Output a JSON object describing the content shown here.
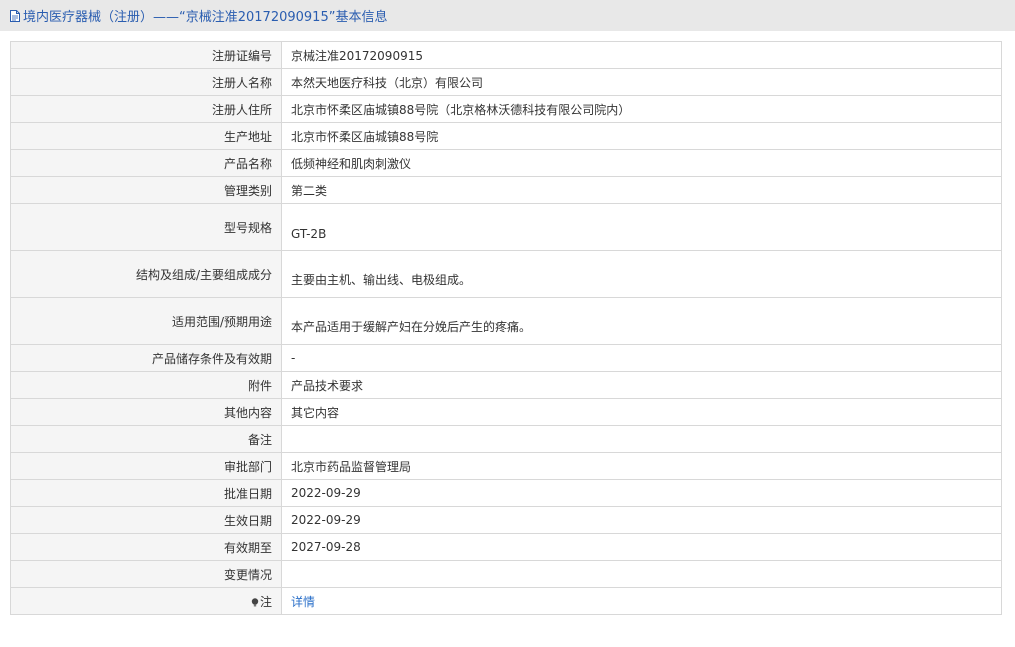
{
  "header": {
    "title": "境内医疗器械（注册）——“京械注准20172090915”基本信息"
  },
  "rows": [
    {
      "label": "注册证编号",
      "value": "京械注准20172090915"
    },
    {
      "label": "注册人名称",
      "value": "本然天地医疗科技（北京）有限公司"
    },
    {
      "label": "注册人住所",
      "value": "北京市怀柔区庙城镇88号院（北京格林沃德科技有限公司院内）"
    },
    {
      "label": "生产地址",
      "value": "北京市怀柔区庙城镇88号院"
    },
    {
      "label": "产品名称",
      "value": "低频神经和肌肉刺激仪"
    },
    {
      "label": "管理类别",
      "value": "第二类"
    },
    {
      "label": "型号规格",
      "value": "GT-2B"
    },
    {
      "label": "结构及组成/主要组成成分",
      "value": "主要由主机、输出线、电极组成。"
    },
    {
      "label": "适用范围/预期用途",
      "value": "本产品适用于缓解产妇在分娩后产生的疼痛。"
    },
    {
      "label": "产品储存条件及有效期",
      "value": "-"
    },
    {
      "label": "附件",
      "value": "产品技术要求"
    },
    {
      "label": "其他内容",
      "value": "其它内容"
    },
    {
      "label": "备注",
      "value": ""
    },
    {
      "label": "审批部门",
      "value": "北京市药品监督管理局"
    },
    {
      "label": "批准日期",
      "value": "2022-09-29"
    },
    {
      "label": "生效日期",
      "value": "2022-09-29"
    },
    {
      "label": "有效期至",
      "value": "2027-09-28"
    },
    {
      "label": "变更情况",
      "value": ""
    },
    {
      "label": "注",
      "value": "详情"
    }
  ]
}
